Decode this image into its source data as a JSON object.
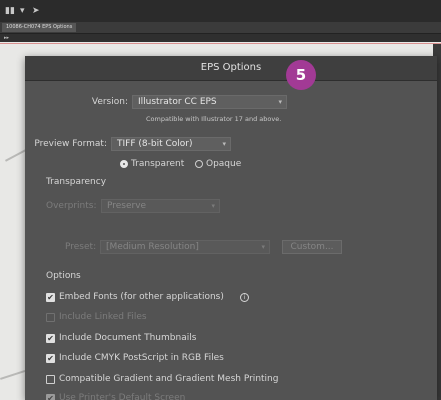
{
  "background": {
    "tab_label": "10086-CH074 EPS Options"
  },
  "dialog": {
    "title": "EPS Options",
    "step_badge": "5",
    "version": {
      "label": "Version:",
      "value": "Illustrator CC EPS",
      "compat_note": "Compatible with Illustrator 17 and above."
    },
    "preview": {
      "label": "Preview Format:",
      "value": "TIFF (8-bit Color)",
      "transparent_label": "Transparent",
      "transparent_selected": true,
      "opaque_label": "Opaque",
      "opaque_selected": false
    },
    "transparency": {
      "heading": "Transparency",
      "overprints_label": "Overprints:",
      "overprints_value": "Preserve",
      "preset_label": "Preset:",
      "preset_value": "[Medium Resolution]",
      "custom_label": "Custom..."
    },
    "options": {
      "heading": "Options",
      "embed_fonts": {
        "label": "Embed Fonts (for other applications)",
        "checked": true
      },
      "include_linked": {
        "label": "Include Linked Files",
        "checked": false,
        "disabled": true
      },
      "doc_thumbnails": {
        "label": "Include Document Thumbnails",
        "checked": true
      },
      "cmyk_postscript": {
        "label": "Include CMYK PostScript in RGB Files",
        "checked": true
      },
      "gradient_mesh": {
        "label": "Compatible Gradient and Gradient Mesh Printing",
        "checked": false
      },
      "printer_screens": {
        "label": "Use Printer's Default Screen",
        "checked": true,
        "disabled": true
      }
    }
  },
  "colors": {
    "dialog_bg": "#535353",
    "title_bg": "#3f3f3f",
    "badge": "#a23a95"
  }
}
